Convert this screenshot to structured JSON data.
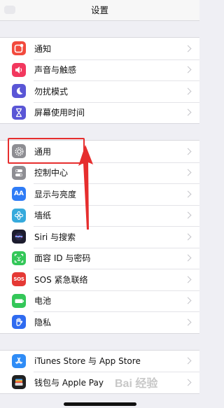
{
  "header": {
    "title": "设置"
  },
  "group1": [
    {
      "label": "通知",
      "icon": "notification-icon",
      "color": "#f24a3d"
    },
    {
      "label": "声音与触感",
      "icon": "sound-icon",
      "color": "#f2385e"
    },
    {
      "label": "勿扰模式",
      "icon": "moon-icon",
      "color": "#5a56d6"
    },
    {
      "label": "屏幕使用时间",
      "icon": "hourglass-icon",
      "color": "#5a56d6"
    }
  ],
  "group2": [
    {
      "label": "通用",
      "icon": "gear-icon",
      "color": "#8e8e93"
    },
    {
      "label": "控制中心",
      "icon": "toggle-icon",
      "color": "#8e8e93"
    },
    {
      "label": "显示与亮度",
      "icon": "display-aa-icon",
      "color": "#2f7cf6",
      "glyph": "AA"
    },
    {
      "label": "墙纸",
      "icon": "wallpaper-flower-icon",
      "color": "#36aadc"
    },
    {
      "label": "Siri 与搜索",
      "icon": "siri-icon",
      "color": "#1c1c2e"
    },
    {
      "label": "面容 ID 与密码",
      "icon": "face-id-icon",
      "color": "#34c759"
    },
    {
      "label": "SOS 紧急联络",
      "icon": "sos-icon",
      "color": "#e53935",
      "glyph": "SOS"
    },
    {
      "label": "电池",
      "icon": "battery-icon",
      "color": "#34c759"
    },
    {
      "label": "隐私",
      "icon": "hand-icon",
      "color": "#2f6bf0"
    }
  ],
  "group3": [
    {
      "label": "iTunes Store 与 App Store",
      "icon": "app-store-icon",
      "color": "#2f8cf6"
    },
    {
      "label": "钱包与 Apple Pay",
      "icon": "wallet-icon",
      "color": "#222222"
    }
  ],
  "watermark": {
    "text": "Bai 经验"
  }
}
